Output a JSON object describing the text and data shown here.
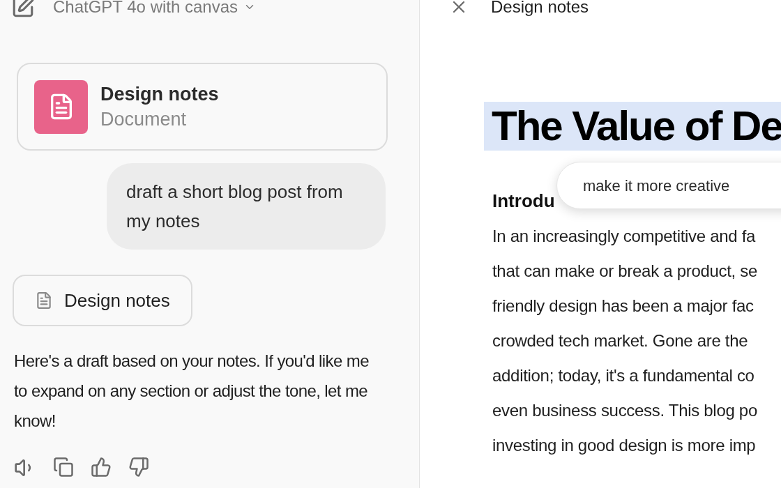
{
  "chat": {
    "model_selector": "ChatGPT 4o with canvas",
    "canvas_card": {
      "title": "Design notes",
      "subtitle": "Document"
    },
    "user_message": "draft a short blog post from my notes",
    "doc_chip": "Design notes",
    "assistant_message": "Here's a draft based on your notes. If you'd like me to expand on any section or adjust the tone, let me know!"
  },
  "canvas": {
    "title": "Design notes",
    "heading": "The Value of De",
    "heading_selected": true,
    "subheading": "Introdu",
    "edit_prompt": "make it more creative",
    "lines": [
      "In an increasingly competitive and fa",
      "that can make or break a product, se",
      "friendly design has been a major fac",
      "crowded tech market. Gone are the",
      "addition; today, it's a fundamental co",
      "even business success. This blog po",
      "investing in good design is more imp"
    ]
  }
}
